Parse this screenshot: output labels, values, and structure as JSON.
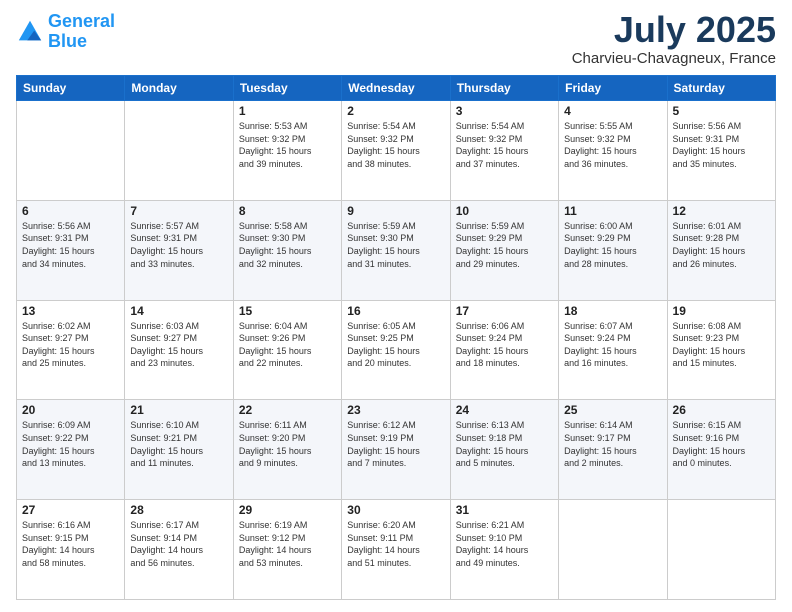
{
  "header": {
    "logo_line1": "General",
    "logo_line2": "Blue",
    "month": "July 2025",
    "location": "Charvieu-Chavagneux, France"
  },
  "weekdays": [
    "Sunday",
    "Monday",
    "Tuesday",
    "Wednesday",
    "Thursday",
    "Friday",
    "Saturday"
  ],
  "weeks": [
    [
      {
        "day": "",
        "info": ""
      },
      {
        "day": "",
        "info": ""
      },
      {
        "day": "1",
        "info": "Sunrise: 5:53 AM\nSunset: 9:32 PM\nDaylight: 15 hours\nand 39 minutes."
      },
      {
        "day": "2",
        "info": "Sunrise: 5:54 AM\nSunset: 9:32 PM\nDaylight: 15 hours\nand 38 minutes."
      },
      {
        "day": "3",
        "info": "Sunrise: 5:54 AM\nSunset: 9:32 PM\nDaylight: 15 hours\nand 37 minutes."
      },
      {
        "day": "4",
        "info": "Sunrise: 5:55 AM\nSunset: 9:32 PM\nDaylight: 15 hours\nand 36 minutes."
      },
      {
        "day": "5",
        "info": "Sunrise: 5:56 AM\nSunset: 9:31 PM\nDaylight: 15 hours\nand 35 minutes."
      }
    ],
    [
      {
        "day": "6",
        "info": "Sunrise: 5:56 AM\nSunset: 9:31 PM\nDaylight: 15 hours\nand 34 minutes."
      },
      {
        "day": "7",
        "info": "Sunrise: 5:57 AM\nSunset: 9:31 PM\nDaylight: 15 hours\nand 33 minutes."
      },
      {
        "day": "8",
        "info": "Sunrise: 5:58 AM\nSunset: 9:30 PM\nDaylight: 15 hours\nand 32 minutes."
      },
      {
        "day": "9",
        "info": "Sunrise: 5:59 AM\nSunset: 9:30 PM\nDaylight: 15 hours\nand 31 minutes."
      },
      {
        "day": "10",
        "info": "Sunrise: 5:59 AM\nSunset: 9:29 PM\nDaylight: 15 hours\nand 29 minutes."
      },
      {
        "day": "11",
        "info": "Sunrise: 6:00 AM\nSunset: 9:29 PM\nDaylight: 15 hours\nand 28 minutes."
      },
      {
        "day": "12",
        "info": "Sunrise: 6:01 AM\nSunset: 9:28 PM\nDaylight: 15 hours\nand 26 minutes."
      }
    ],
    [
      {
        "day": "13",
        "info": "Sunrise: 6:02 AM\nSunset: 9:27 PM\nDaylight: 15 hours\nand 25 minutes."
      },
      {
        "day": "14",
        "info": "Sunrise: 6:03 AM\nSunset: 9:27 PM\nDaylight: 15 hours\nand 23 minutes."
      },
      {
        "day": "15",
        "info": "Sunrise: 6:04 AM\nSunset: 9:26 PM\nDaylight: 15 hours\nand 22 minutes."
      },
      {
        "day": "16",
        "info": "Sunrise: 6:05 AM\nSunset: 9:25 PM\nDaylight: 15 hours\nand 20 minutes."
      },
      {
        "day": "17",
        "info": "Sunrise: 6:06 AM\nSunset: 9:24 PM\nDaylight: 15 hours\nand 18 minutes."
      },
      {
        "day": "18",
        "info": "Sunrise: 6:07 AM\nSunset: 9:24 PM\nDaylight: 15 hours\nand 16 minutes."
      },
      {
        "day": "19",
        "info": "Sunrise: 6:08 AM\nSunset: 9:23 PM\nDaylight: 15 hours\nand 15 minutes."
      }
    ],
    [
      {
        "day": "20",
        "info": "Sunrise: 6:09 AM\nSunset: 9:22 PM\nDaylight: 15 hours\nand 13 minutes."
      },
      {
        "day": "21",
        "info": "Sunrise: 6:10 AM\nSunset: 9:21 PM\nDaylight: 15 hours\nand 11 minutes."
      },
      {
        "day": "22",
        "info": "Sunrise: 6:11 AM\nSunset: 9:20 PM\nDaylight: 15 hours\nand 9 minutes."
      },
      {
        "day": "23",
        "info": "Sunrise: 6:12 AM\nSunset: 9:19 PM\nDaylight: 15 hours\nand 7 minutes."
      },
      {
        "day": "24",
        "info": "Sunrise: 6:13 AM\nSunset: 9:18 PM\nDaylight: 15 hours\nand 5 minutes."
      },
      {
        "day": "25",
        "info": "Sunrise: 6:14 AM\nSunset: 9:17 PM\nDaylight: 15 hours\nand 2 minutes."
      },
      {
        "day": "26",
        "info": "Sunrise: 6:15 AM\nSunset: 9:16 PM\nDaylight: 15 hours\nand 0 minutes."
      }
    ],
    [
      {
        "day": "27",
        "info": "Sunrise: 6:16 AM\nSunset: 9:15 PM\nDaylight: 14 hours\nand 58 minutes."
      },
      {
        "day": "28",
        "info": "Sunrise: 6:17 AM\nSunset: 9:14 PM\nDaylight: 14 hours\nand 56 minutes."
      },
      {
        "day": "29",
        "info": "Sunrise: 6:19 AM\nSunset: 9:12 PM\nDaylight: 14 hours\nand 53 minutes."
      },
      {
        "day": "30",
        "info": "Sunrise: 6:20 AM\nSunset: 9:11 PM\nDaylight: 14 hours\nand 51 minutes."
      },
      {
        "day": "31",
        "info": "Sunrise: 6:21 AM\nSunset: 9:10 PM\nDaylight: 14 hours\nand 49 minutes."
      },
      {
        "day": "",
        "info": ""
      },
      {
        "day": "",
        "info": ""
      }
    ]
  ]
}
